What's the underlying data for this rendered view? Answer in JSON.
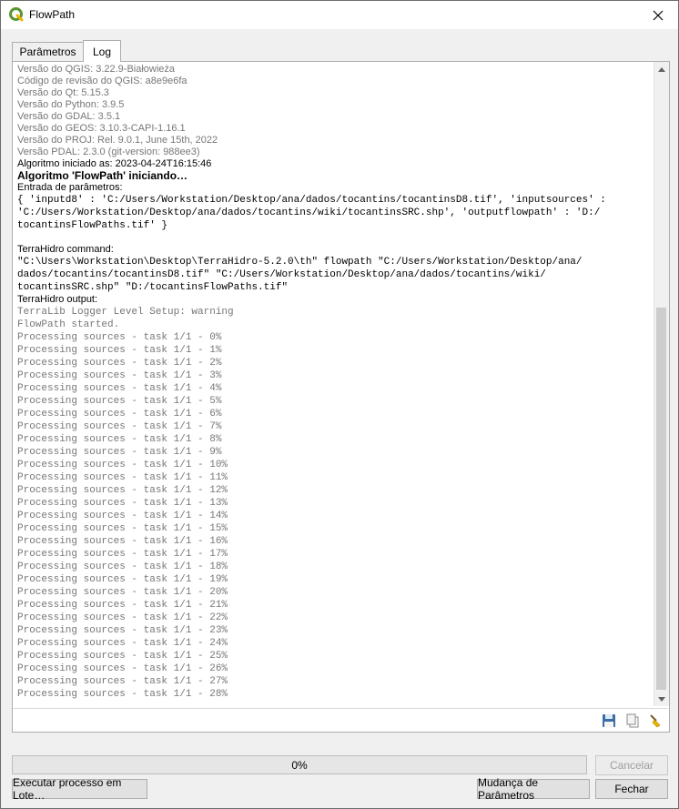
{
  "window": {
    "title": "FlowPath"
  },
  "tabs": [
    {
      "label": "Parâmetros"
    },
    {
      "label": "Log"
    }
  ],
  "log": {
    "header": [
      "Versão do QGIS: 3.22.9-Białowieża",
      "Código de revisão do QGIS: a8e9e6fa",
      "Versão do Qt: 5.15.3",
      "Versão do Python: 3.9.5",
      "Versão do GDAL: 3.5.1",
      "Versão do GEOS: 3.10.3-CAPI-1.16.1",
      "Versão do PROJ: Rel. 9.0.1, June 15th, 2022",
      "Versão PDAL: 2.3.0 (git-version: 988ee3)"
    ],
    "started_at": "Algoritmo iniciado as: 2023-04-24T16:15:46",
    "starting": "Algoritmo 'FlowPath' iniciando…",
    "params_label": "Entrada de parâmetros:",
    "params": [
      "{ 'inputd8' : 'C:/Users/Workstation/Desktop/ana/dados/tocantins/tocantinsD8.tif', 'inputsources' :",
      "'C:/Users/Workstation/Desktop/ana/dados/tocantins/wiki/tocantinsSRC.shp', 'outputflowpath' : 'D:/",
      "tocantinsFlowPaths.tif' }"
    ],
    "command_label": "TerraHidro command:",
    "command": [
      "\"C:\\Users\\Workstation\\Desktop\\TerraHidro-5.2.0\\th\" flowpath \"C:/Users/Workstation/Desktop/ana/",
      "dados/tocantins/tocantinsD8.tif\" \"C:/Users/Workstation/Desktop/ana/dados/tocantins/wiki/",
      "tocantinsSRC.shp\" \"D:/tocantinsFlowPaths.tif\""
    ],
    "output_label": "TerraHidro output:",
    "output_gray": [
      "TerraLib Logger Level Setup: warning",
      "FlowPath started."
    ],
    "output": [
      "Processing sources - task 1/1 - 0%",
      "Processing sources - task 1/1 - 1%",
      "Processing sources - task 1/1 - 2%",
      "Processing sources - task 1/1 - 3%",
      "Processing sources - task 1/1 - 4%",
      "Processing sources - task 1/1 - 5%",
      "Processing sources - task 1/1 - 6%",
      "Processing sources - task 1/1 - 7%",
      "Processing sources - task 1/1 - 8%",
      "Processing sources - task 1/1 - 9%",
      "Processing sources - task 1/1 - 10%",
      "Processing sources - task 1/1 - 11%",
      "Processing sources - task 1/1 - 12%",
      "Processing sources - task 1/1 - 13%",
      "Processing sources - task 1/1 - 14%",
      "Processing sources - task 1/1 - 15%",
      "Processing sources - task 1/1 - 16%",
      "Processing sources - task 1/1 - 17%",
      "Processing sources - task 1/1 - 18%",
      "Processing sources - task 1/1 - 19%",
      "Processing sources - task 1/1 - 20%",
      "Processing sources - task 1/1 - 21%",
      "Processing sources - task 1/1 - 22%",
      "Processing sources - task 1/1 - 23%",
      "Processing sources - task 1/1 - 24%",
      "Processing sources - task 1/1 - 25%",
      "Processing sources - task 1/1 - 26%",
      "Processing sources - task 1/1 - 27%",
      "Processing sources - task 1/1 - 28%"
    ]
  },
  "panel_icons": [
    "save-icon",
    "copy-icon",
    "clear-icon"
  ],
  "progress": {
    "text": "0%",
    "value": 0
  },
  "buttons": {
    "cancel": "Cancelar",
    "batch": "Executar processo em Lote…",
    "change_params": "Mudança de Parâmetros",
    "close": "Fechar"
  },
  "colors": {
    "gray_text": "#777777",
    "accent_green": "#589632",
    "accent_yellow": "#f0b400"
  }
}
